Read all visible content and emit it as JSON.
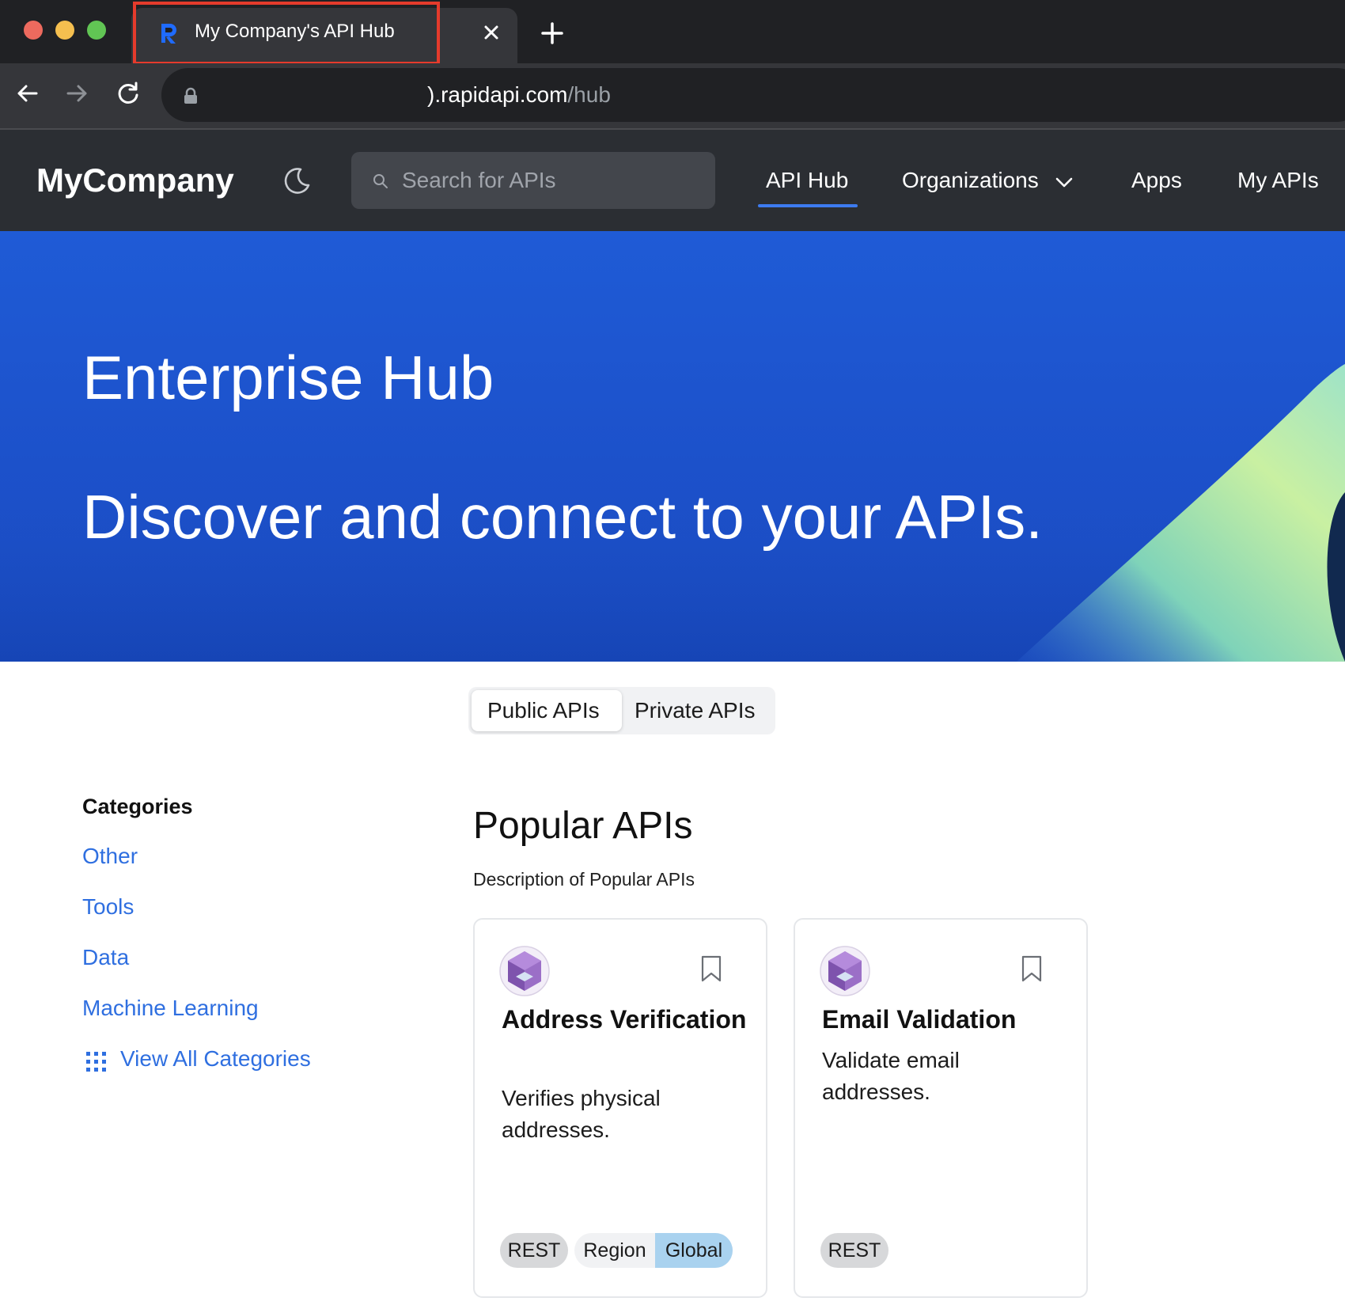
{
  "browser": {
    "tab_title": "My Company's API Hub",
    "url_host": ").rapidapi.com",
    "url_path": "/hub"
  },
  "header": {
    "brand": "MyCompany",
    "search_placeholder": "Search for APIs",
    "nav": {
      "api_hub": "API Hub",
      "organizations": "Organizations",
      "apps": "Apps",
      "my_apis": "My APIs"
    },
    "active_nav": "API Hub"
  },
  "hero": {
    "title": "Enterprise Hub",
    "subtitle": "Discover and connect to your APIs."
  },
  "toggle": {
    "public": "Public APIs",
    "private": "Private APIs",
    "selected": "Public APIs"
  },
  "sidebar": {
    "heading": "Categories",
    "items": [
      "Other",
      "Tools",
      "Data",
      "Machine Learning"
    ],
    "view_all": "View All Categories"
  },
  "popular": {
    "title": "Popular APIs",
    "description": "Description of Popular APIs",
    "cards": [
      {
        "name": "Address Verification",
        "description": "Verifies physical addresses.",
        "tags": {
          "type": "REST",
          "region_label": "Region",
          "region_value": "Global"
        }
      },
      {
        "name": "Email Validation",
        "description": "Validate email addresses.",
        "tags": {
          "type": "REST"
        }
      }
    ]
  },
  "colors": {
    "chrome_dark": "#202124",
    "chrome_tab": "#35363a",
    "highlight": "#e53b2c",
    "header_bg": "#2b2e33",
    "hero_blue": "#1f5bd6",
    "link_blue": "#2f6fe0",
    "region_pill": "#a9d2ef"
  }
}
